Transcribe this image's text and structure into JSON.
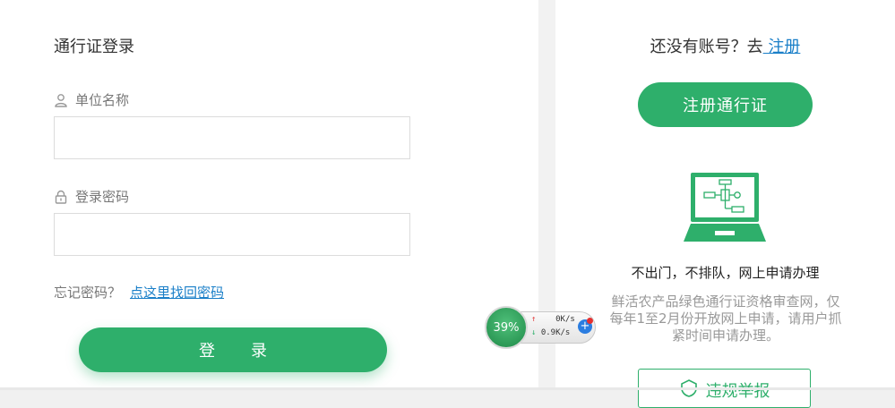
{
  "login": {
    "title": "通行证登录",
    "unit_label": "单位名称",
    "unit_value": "",
    "password_label": "登录密码",
    "password_value": "",
    "forgot_prefix": "忘记密码？",
    "forgot_link": "点这里找回密码",
    "login_button": "登录"
  },
  "register": {
    "prompt": "还没有账号？去",
    "register_link": " 注册",
    "register_button": "注册通行证",
    "tagline": "不出门，不排队，网上申请办理",
    "description": "鲜活农产品绿色通行证资格审查网，仅每年1至2月份开放网上申请，请用户抓紧时间申请办理。",
    "report_button": "违规举报"
  },
  "net_monitor": {
    "percent": "39%",
    "upload": "0K/s",
    "download": "0.9K/s"
  },
  "colors": {
    "accent": "#2eaf6b",
    "link": "#1a7fc8"
  },
  "icons": {
    "unit": "user-icon",
    "password": "lock-icon",
    "illustration": "laptop-flowchart-icon",
    "report": "shield-icon"
  }
}
